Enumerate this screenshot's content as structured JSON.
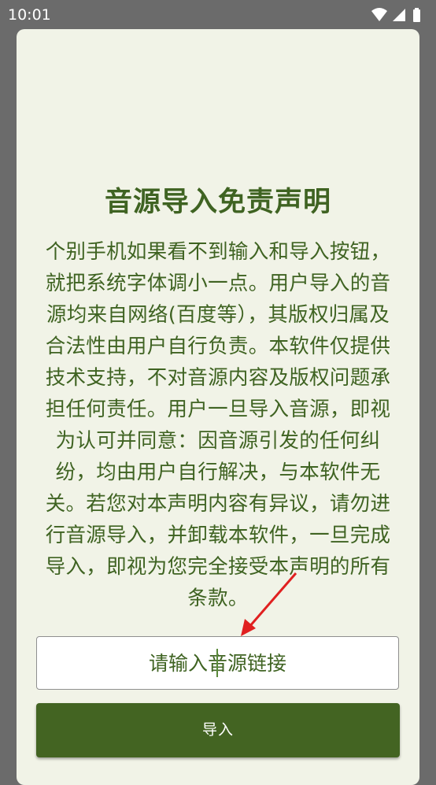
{
  "status_bar": {
    "time": "10:01",
    "icons": [
      "wifi-icon",
      "signal-icon",
      "battery-icon"
    ]
  },
  "dialog": {
    "title": "音源导入免责声明",
    "body": "个别手机如果看不到输入和导入按钮，就把系统字体调小一点。用户导入的音源均来自网络(百度等），其版权归属及合法性由用户自行负责。本软件仅提供技术支持，不对音源内容及版权问题承担任何责任。用户一旦导入音源，即视为认可并同意：因音源引发的任何纠纷，均由用户自行解决，与本软件无关。若您对本声明内容有异议，请勿进行音源导入，并卸载本软件，一旦完成导入，即视为您完全接受本声明的所有条款。",
    "input": {
      "value": "",
      "placeholder": "请输入音源链接"
    },
    "import_button": "导入"
  },
  "colors": {
    "accent": "#436422",
    "text": "#3f6322",
    "dialog_bg": "#f1f3e7",
    "scrim": "#6b6b6b",
    "annotation_arrow": "#e02020"
  }
}
